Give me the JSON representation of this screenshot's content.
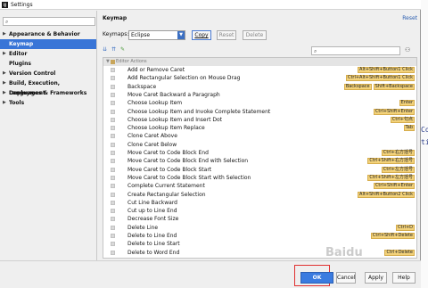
{
  "window": {
    "title": "Settings",
    "app_icon_letter": "IJ"
  },
  "sidebar": {
    "items": [
      {
        "label": "Appearance & Behavior",
        "arrow": "▶",
        "selected": false
      },
      {
        "label": "Keymap",
        "arrow": "",
        "selected": true
      },
      {
        "label": "Editor",
        "arrow": "▶",
        "selected": false
      },
      {
        "label": "Plugins",
        "arrow": "",
        "selected": false
      },
      {
        "label": "Version Control",
        "arrow": "▶",
        "selected": false
      },
      {
        "label": "Build, Execution, Deployment",
        "arrow": "▶",
        "selected": false
      },
      {
        "label": "Languages & Frameworks",
        "arrow": "▶",
        "selected": false
      },
      {
        "label": "Tools",
        "arrow": "▶",
        "selected": false
      }
    ]
  },
  "main": {
    "heading": "Keymap",
    "reset_link": "Reset",
    "keymaps_label": "Keymaps:",
    "keymap_selected": "Eclipse",
    "copy_label": "Copy",
    "reset_label": "Reset",
    "delete_label": "Delete",
    "root_label": "Editor Actions",
    "actions": [
      {
        "name": "Add or Remove Caret",
        "shortcuts": [
          "Alt+Shift+Button1 Click"
        ]
      },
      {
        "name": "Add Rectangular Selection on Mouse Drag",
        "shortcuts": [
          "Ctrl+Alt+Shift+Button1 Click"
        ]
      },
      {
        "name": "Backspace",
        "shortcuts": [
          "Backspace",
          "Shift+Backspace"
        ]
      },
      {
        "name": "Move Caret Backward a Paragraph",
        "shortcuts": []
      },
      {
        "name": "Choose Lookup Item",
        "shortcuts": [
          "Enter"
        ]
      },
      {
        "name": "Choose Lookup Item and Invoke Complete Statement",
        "shortcuts": [
          "Ctrl+Shift+Enter"
        ]
      },
      {
        "name": "Choose Lookup Item and Insert Dot",
        "shortcuts": [
          "Ctrl+句点"
        ]
      },
      {
        "name": "Choose Lookup Item Replace",
        "shortcuts": [
          "Tab"
        ]
      },
      {
        "name": "Clone Caret Above",
        "shortcuts": []
      },
      {
        "name": "Clone Caret Below",
        "shortcuts": []
      },
      {
        "name": "Move Caret to Code Block End",
        "shortcuts": [
          "Ctrl+右方括号"
        ]
      },
      {
        "name": "Move Caret to Code Block End with Selection",
        "shortcuts": [
          "Ctrl+Shift+右方括号"
        ]
      },
      {
        "name": "Move Caret to Code Block Start",
        "shortcuts": [
          "Ctrl+左方括号"
        ]
      },
      {
        "name": "Move Caret to Code Block Start with Selection",
        "shortcuts": [
          "Ctrl+Shift+左方括号"
        ]
      },
      {
        "name": "Complete Current Statement",
        "shortcuts": [
          "Ctrl+Shift+Enter"
        ]
      },
      {
        "name": "Create Rectangular Selection",
        "shortcuts": [
          "Alt+Shift+Button2 Click"
        ]
      },
      {
        "name": "Cut Line Backward",
        "shortcuts": []
      },
      {
        "name": "Cut up to Line End",
        "shortcuts": []
      },
      {
        "name": "Decrease Font Size",
        "shortcuts": []
      },
      {
        "name": "Delete Line",
        "shortcuts": [
          "Ctrl+D"
        ]
      },
      {
        "name": "Delete to Line End",
        "shortcuts": [
          "Ctrl+Shift+Delete"
        ]
      },
      {
        "name": "Delete to Line Start",
        "shortcuts": []
      },
      {
        "name": "Delete to Word End",
        "shortcuts": [
          "Ctrl+Delete"
        ]
      }
    ]
  },
  "footer": {
    "ok_label": "OK",
    "cancel_label": "Cancel",
    "apply_label": "Apply",
    "help_label": "Help"
  },
  "watermark": "Baidu",
  "right_strip": {
    "line1": "Co",
    "line2": "ti"
  },
  "colors": {
    "accent": "#3875d7",
    "shortcut_bg": "#f3d27a",
    "ok_button": "#3a7be0",
    "highlight_box": "#e03030"
  }
}
